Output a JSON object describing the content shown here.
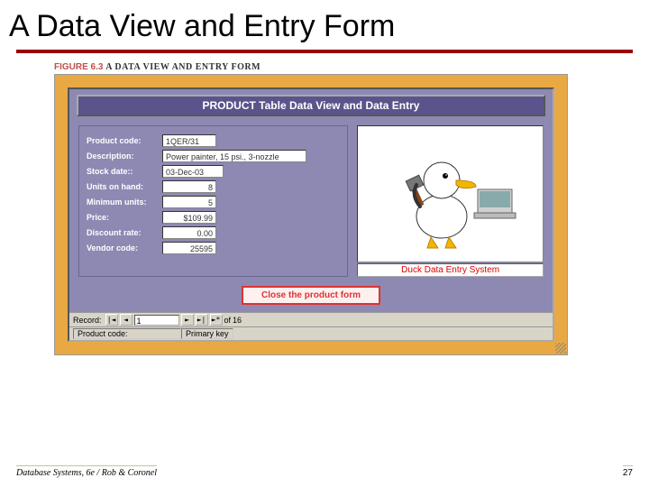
{
  "slide": {
    "title": "A Data View and Entry Form",
    "figure_label": "FIGURE 6.3",
    "figure_title": "A DATA VIEW AND ENTRY FORM",
    "footer_source": "Database Systems, 6e / Rob & Coronel",
    "page_number": "27"
  },
  "form": {
    "header": "PRODUCT Table Data View and Data Entry",
    "fields": {
      "product_code": {
        "label": "Product code:",
        "value": "1QER/31"
      },
      "description": {
        "label": "Description:",
        "value": "Power painter, 15 psi., 3-nozzle"
      },
      "stock_date": {
        "label": "Stock date::",
        "value": "03-Dec-03"
      },
      "units_on_hand": {
        "label": "Units on hand:",
        "value": "8"
      },
      "minimum_units": {
        "label": "Minimum units:",
        "value": "5"
      },
      "price": {
        "label": "Price:",
        "value": "$109.99"
      },
      "discount_rate": {
        "label": "Discount rate:",
        "value": "0.00"
      },
      "vendor_code": {
        "label": "Vendor code:",
        "value": "25595"
      }
    },
    "image_caption": "Duck Data Entry System",
    "close_label": "Close the product form",
    "nav": {
      "label": "Record:",
      "current": "1",
      "of_label": "of",
      "total": "16"
    },
    "status": {
      "field": "Product code:",
      "desc": "Primary key"
    }
  },
  "icons": {
    "nav_first": "|◄",
    "nav_prev": "◄",
    "nav_next": "►",
    "nav_last": "►|",
    "nav_new": "►*"
  }
}
